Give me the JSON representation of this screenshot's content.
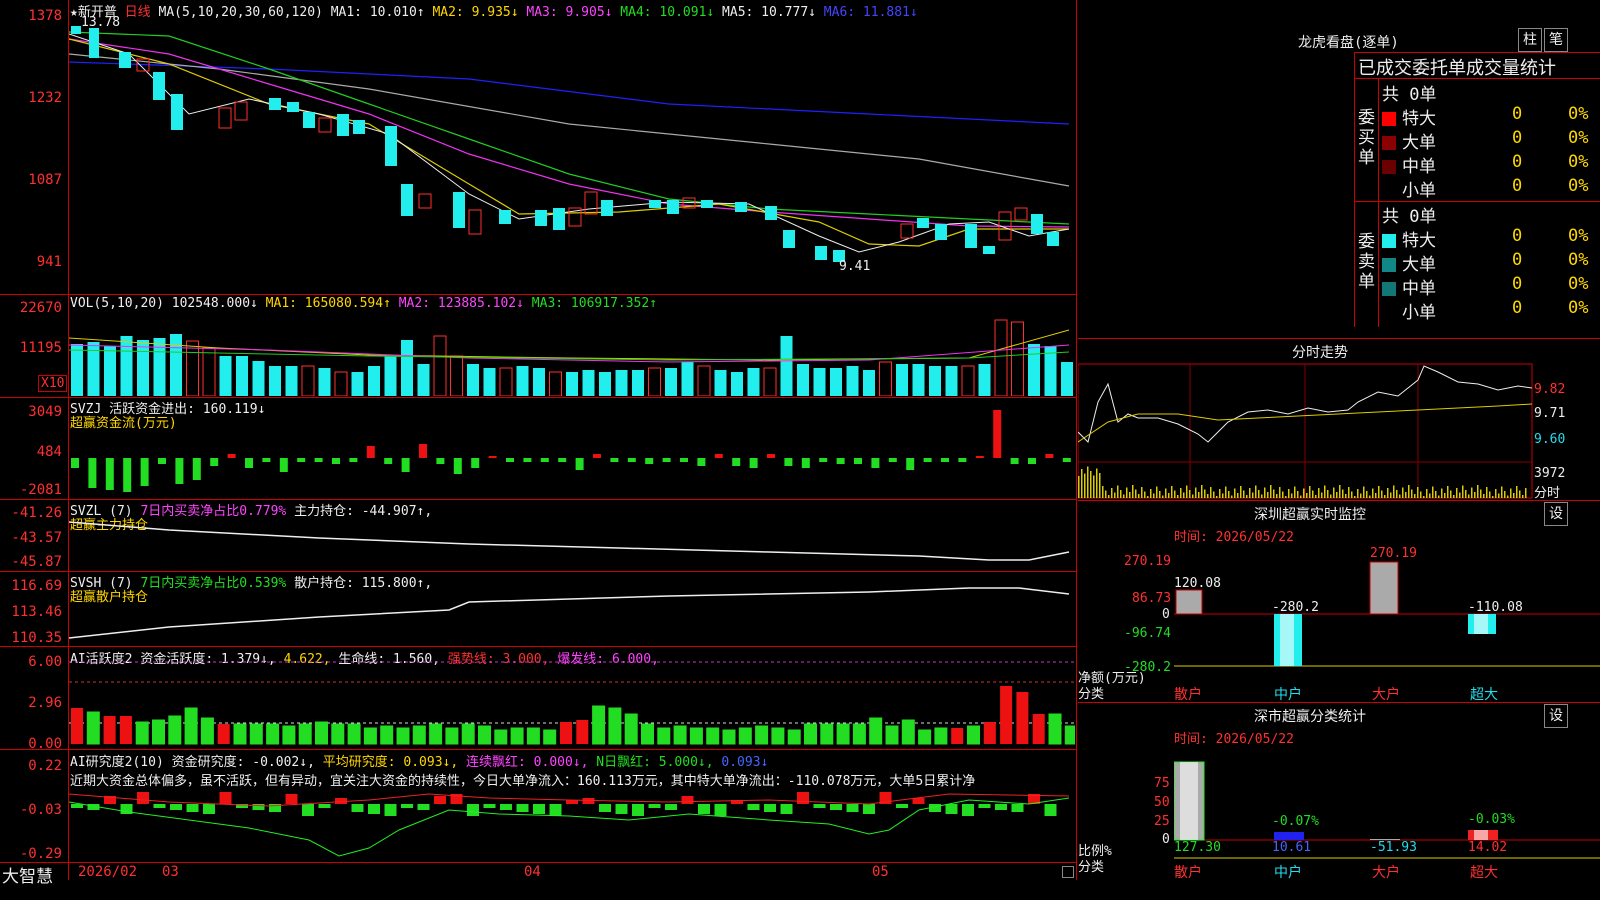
{
  "stock": {
    "name": "★新开普",
    "period": "日线",
    "high_marker": "13.78",
    "low_marker": "9.41"
  },
  "ma_line": {
    "label": "MA(5,10,20,30,60,120)",
    "ma1": "MA1: 10.010↑",
    "ma2": "MA2: 9.935↓",
    "ma3": "MA3: 9.905↓",
    "ma4": "MA4: 10.091↓",
    "ma5": "MA5: 10.777↓",
    "ma6": "MA6: 11.881↓"
  },
  "price_axis": [
    "1378",
    "1232",
    "1087",
    "941"
  ],
  "vol": {
    "label": "VOL(5,10,20)",
    "value": "102548.000↓",
    "ma1": "MA1: 165080.594↑",
    "ma2": "MA2: 123885.102↓",
    "ma3": "MA3: 106917.352↑",
    "axis": [
      "22670",
      "11195"
    ],
    "unit": "X10"
  },
  "svzj": {
    "label": "SVZJ",
    "title": "活跃资金进出: 160.119↓",
    "subtitle": "超赢资金流(万元)",
    "axis": [
      "3049",
      "484",
      "-2081"
    ]
  },
  "svzl": {
    "label": "SVZL (7)",
    "pct": "7日内买卖净占比0.779%",
    "hold": "主力持仓: -44.907↑,",
    "subtitle": "超赢主力持仓",
    "axis": [
      "-41.26",
      "-43.57",
      "-45.87"
    ]
  },
  "svsh": {
    "label": "SVSH (7)",
    "pct": "7日内买卖净占比0.539%",
    "hold": "散户持仓: 115.800↑,",
    "subtitle": "超赢散户持仓",
    "axis": [
      "116.69",
      "113.46",
      "110.35"
    ]
  },
  "ai_active": {
    "label": "AI活跃度2",
    "fund": "资金活跃度: 1.379↓,",
    "v2": "4.622,",
    "life": "生命线: 1.560,",
    "strong": "强势线: 3.000,",
    "burst": "爆发线: 6.000,",
    "axis": [
      "6.00",
      "2.96",
      "0.00"
    ]
  },
  "ai_research": {
    "label": "AI研究度2(10)",
    "fund": "资金研究度: -0.002↓,",
    "avg": "平均研究度: 0.093↓,",
    "red": "连续飘红: 0.000↓,",
    "nred": "N日飘红: 5.000↓,",
    "last": "0.093↓",
    "axis": [
      "0.22",
      "-0.03",
      "-0.29"
    ],
    "comment": "近期大资金总体偏多，虽不活跃，但有异动，宜关注大资金的持续性，今日大单净流入：160.113万元，其中特大单净流出：-110.078万元，大单5日累计净"
  },
  "date_axis": [
    "2026/02",
    "03",
    "04",
    "05"
  ],
  "brand": "大智慧",
  "right_panel": {
    "dragon_title": "龙虎看盘(逐单)",
    "btn_zhu": "柱",
    "btn_bi": "笔",
    "stat_title": "已成交委托单成交量统计",
    "buy_label": "委买单",
    "sell_label": "委卖单",
    "buy_total": "共 0单",
    "sell_total": "共 0单",
    "buy_rows": [
      {
        "name": "特大",
        "count": "0",
        "pct": "0%",
        "color": "#ff0000"
      },
      {
        "name": "大单",
        "count": "0",
        "pct": "0%",
        "color": "#8b0000"
      },
      {
        "name": "中单",
        "count": "0",
        "pct": "0%",
        "color": "#6b0000"
      },
      {
        "name": "小单",
        "count": "0",
        "pct": "0%",
        "color": "#000000"
      }
    ],
    "sell_rows": [
      {
        "name": "特大",
        "count": "0",
        "pct": "0%",
        "color": "#22eeee"
      },
      {
        "name": "大单",
        "count": "0",
        "pct": "0%",
        "color": "#118888"
      },
      {
        "name": "中单",
        "count": "0",
        "pct": "0%",
        "color": "#117777"
      },
      {
        "name": "小单",
        "count": "0",
        "pct": "0%",
        "color": "#000000"
      }
    ],
    "minute_title": "分时走势",
    "minute_axis": [
      "9.82",
      "9.71",
      "9.60"
    ],
    "minute_vol": "3972",
    "minute_vol_unit": "分时",
    "monitor_title": "深圳超赢实时监控",
    "monitor_time": "时间: 2026/05/22",
    "monitor_btn": "设",
    "monitor_axis": [
      "270.19",
      "86.73",
      "0",
      "-96.74",
      "-280.2"
    ],
    "monitor_ylabel": "净额(万元)",
    "monitor_xlabel": "分类",
    "monitor_cats": [
      "散户",
      "中户",
      "大户",
      "超大"
    ],
    "monitor_values": [
      "120.08",
      "-280.2",
      "270.19",
      "-110.08"
    ],
    "class_title": "深市超赢分类统计",
    "class_time": "时间: 2026/05/22",
    "class_btn": "设",
    "class_axis": [
      "75",
      "50",
      "25",
      "0"
    ],
    "class_ylabel": "比例%",
    "class_xlabel": "分类",
    "class_pct": [
      "-0.07%",
      "-0.03%"
    ],
    "class_values": [
      "127.30",
      "10.61",
      "-51.93",
      "14.02"
    ],
    "class_cats": [
      "散户",
      "中户",
      "大户",
      "超大"
    ]
  },
  "chart_data": [
    {
      "type": "line",
      "title": "K线",
      "ylim": [
        941,
        1378
      ]
    },
    {
      "type": "bar",
      "title": "VOL"
    }
  ]
}
